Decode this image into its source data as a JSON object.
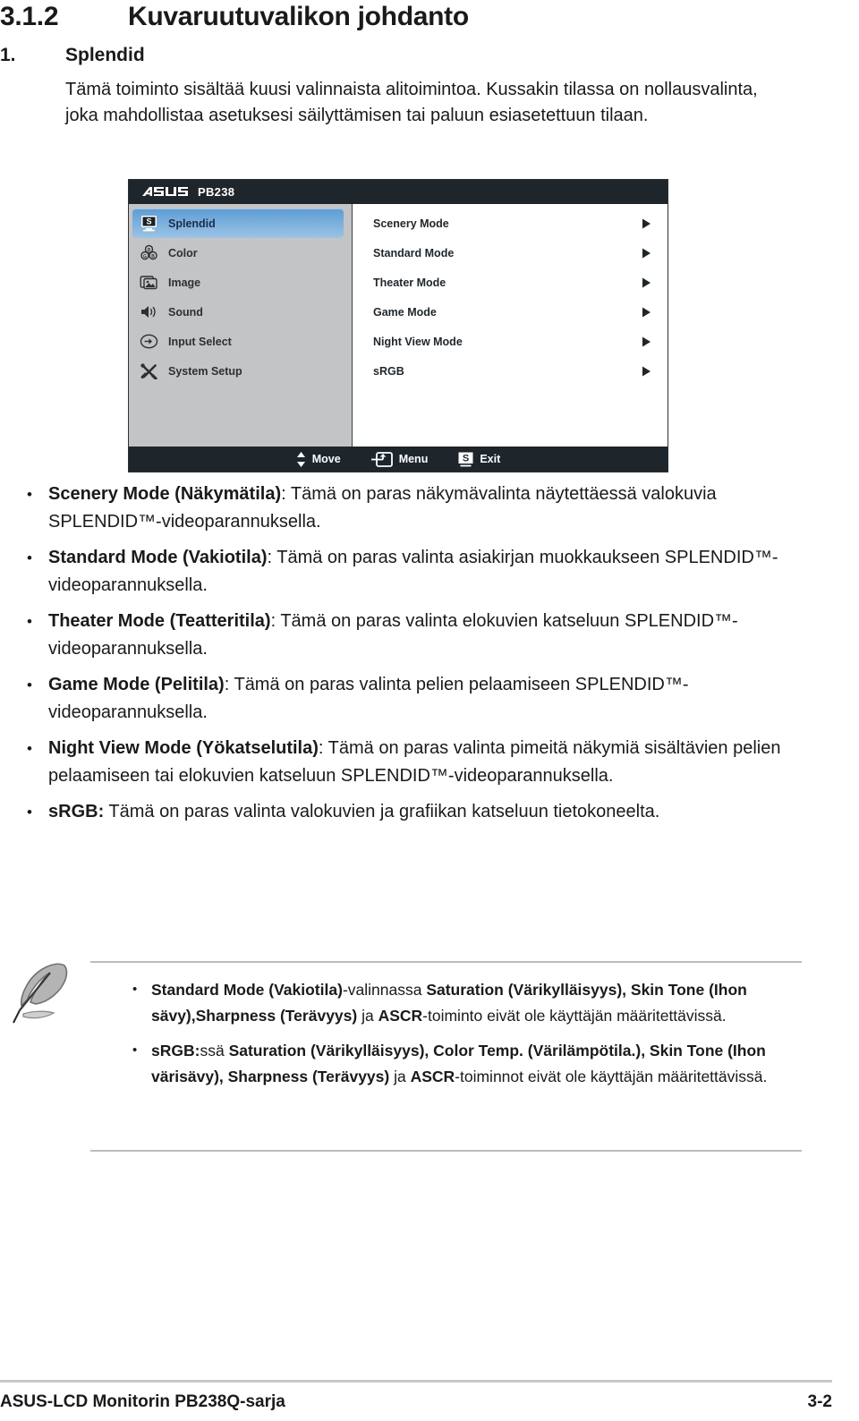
{
  "heading": {
    "number": "3.1.2",
    "title": "Kuvaruutuvalikon johdanto"
  },
  "section": {
    "number": "1.",
    "title": "Splendid",
    "intro": "Tämä toiminto sisältää kuusi valinnaista alitoimintoa. Kussakin tilassa on nollausvalinta, joka mahdollistaa asetuksesi säilyttämisen tai paluun esiasetettuun tilaan."
  },
  "osd": {
    "logo": "asus-logo",
    "model": "PB238",
    "sidebar": [
      {
        "label": "Splendid",
        "icon": "splendid-monitor-icon",
        "active": true
      },
      {
        "label": "Color",
        "icon": "color-circles-icon",
        "active": false
      },
      {
        "label": "Image",
        "icon": "image-frame-icon",
        "active": false
      },
      {
        "label": "Sound",
        "icon": "speaker-icon",
        "active": false
      },
      {
        "label": "Input Select",
        "icon": "input-arrow-icon",
        "active": false
      },
      {
        "label": "System Setup",
        "icon": "tools-icon",
        "active": false
      }
    ],
    "modes": [
      {
        "label": "Scenery Mode",
        "icon": "chevron-right-icon"
      },
      {
        "label": "Standard Mode",
        "icon": "chevron-right-icon"
      },
      {
        "label": "Theater Mode",
        "icon": "chevron-right-icon"
      },
      {
        "label": "Game Mode",
        "icon": "chevron-right-icon"
      },
      {
        "label": "Night View Mode",
        "icon": "chevron-right-icon"
      },
      {
        "label": "sRGB",
        "icon": "chevron-right-icon"
      }
    ],
    "footer": [
      {
        "label": "Move",
        "icon": "up-down-arrows-icon"
      },
      {
        "label": "Menu",
        "icon": "enter-menu-icon"
      },
      {
        "label": "Exit",
        "icon": "splendid-s-icon"
      }
    ],
    "colors": {
      "title_bar": "#1e262c",
      "sidebar": "#c3c4c5",
      "highlight": "#5d9bd4",
      "panel": "#ffffff"
    }
  },
  "bullets": [
    {
      "marker": "•",
      "bold": "Scenery Mode (Näkymätila)",
      "rest": ": Tämä on paras näkymävalinta näytettäessä valokuvia SPLENDID™-videoparannuksella."
    },
    {
      "marker": "•",
      "bold": "Standard Mode (Vakiotila)",
      "rest": ": Tämä on paras valinta asiakirjan muokkaukseen SPLENDID™-videoparannuksella."
    },
    {
      "marker": "•",
      "bold": "Theater Mode (Teatteritila)",
      "rest": ": Tämä on paras valinta elokuvien katseluun SPLENDID™-videoparannuksella."
    },
    {
      "marker": "•",
      "bold": "Game Mode (Pelitila)",
      "rest": ": Tämä on paras valinta pelien pelaamiseen SPLENDID™-videoparannuksella."
    },
    {
      "marker": "•",
      "bold": "Night View Mode (Yökatselutila)",
      "rest": ": Tämä on paras valinta pimeitä näkymiä sisältävien pelien pelaamiseen tai elokuvien katseluun SPLENDID™-videoparannuksella."
    },
    {
      "marker": "•",
      "bold": "sRGB:",
      "rest": " Tämä on paras valinta valokuvien ja grafiikan katseluun tietokoneelta."
    }
  ],
  "note": {
    "icon": "quill-pen-icon",
    "items": [
      {
        "marker": "•",
        "seg1_bold": "Standard Mode (Vakiotila)",
        "seg2": "-valinnassa ",
        "seg3_bold": "Saturation (Värikylläisyys), Skin Tone (Ihon sävy),Sharpness (Terävyys)",
        "seg4": " ja ",
        "seg5_bold": "ASCR",
        "seg6": "-toiminto eivät ole käyttäjän määritettävissä."
      },
      {
        "marker": "•",
        "seg1_bold": "sRGB:",
        "seg2": "ssä ",
        "seg3_bold": "Saturation (Värikylläisyys), Color Temp. (Värilämpötila.), Skin Tone (Ihon värisävy), Sharpness (Terävyys)",
        "seg4": " ja ",
        "seg5_bold": "ASCR",
        "seg6": "-toiminnot eivät ole käyttäjän määritettävissä."
      }
    ]
  },
  "page_footer": {
    "left": "ASUS-LCD Monitorin PB238Q-sarja",
    "right": "3-2"
  }
}
